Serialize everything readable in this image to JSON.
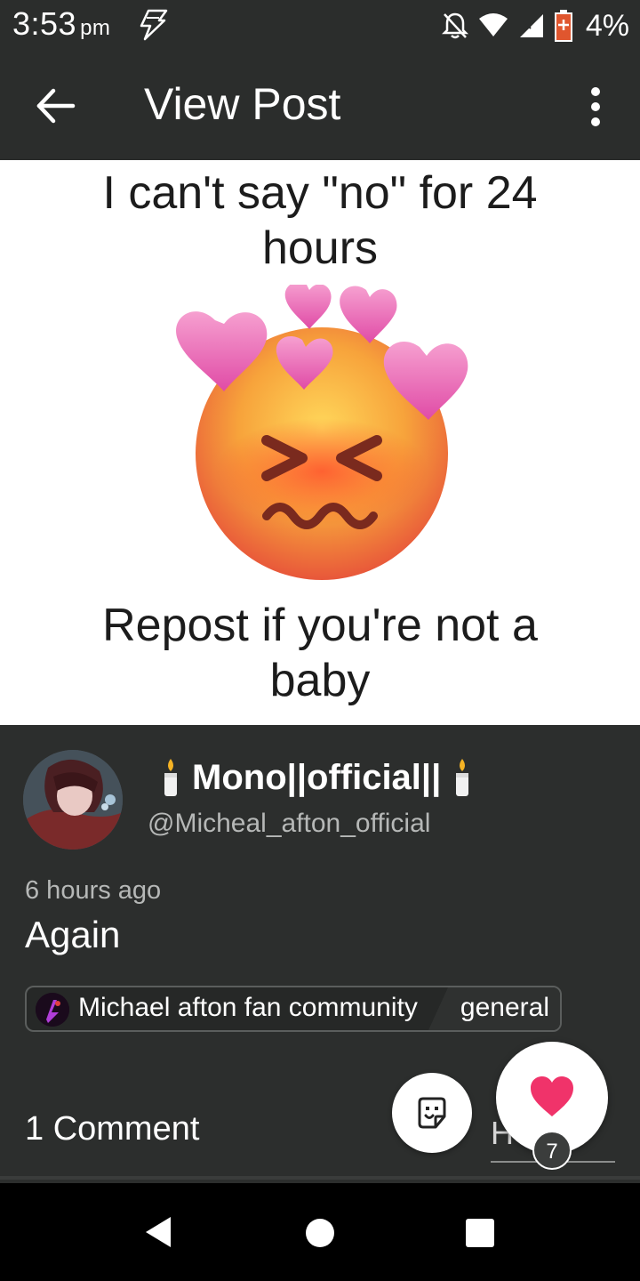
{
  "status_bar": {
    "time": "3:53",
    "ampm": "pm",
    "battery_percent": "4%",
    "icons": [
      "flash-icon",
      "notifications-off-icon",
      "wifi-icon",
      "signal-icon",
      "battery-low-icon"
    ]
  },
  "app_bar": {
    "title": "View Post",
    "back_icon": "arrow-back-icon",
    "menu_icon": "more-vert-icon"
  },
  "post_image": {
    "top_text": "I can't say \"no\" for 24 hours",
    "bottom_text": "Repost if you're not a baby",
    "image_subject": "flushed-face-with-hearts-emoji"
  },
  "author": {
    "name": "Mono||official||",
    "handle": "@Micheal_afton_official",
    "decoration_icon": "candle-icon"
  },
  "post": {
    "time": "6 hours ago",
    "title": "Again",
    "community": "Michael afton fan community",
    "category": "general"
  },
  "footer": {
    "comment_count_label": "1 Comment",
    "input_hint": "H",
    "like_count": "7",
    "like_color": "#f0336a",
    "sticker_icon": "sticker-icon"
  },
  "colors": {
    "background": "#2c2e2d",
    "bar": "#2b2d2c",
    "like": "#f0336a"
  },
  "nav_bar": {
    "icons": [
      "nav-back-icon",
      "nav-home-icon",
      "nav-recents-icon"
    ]
  }
}
